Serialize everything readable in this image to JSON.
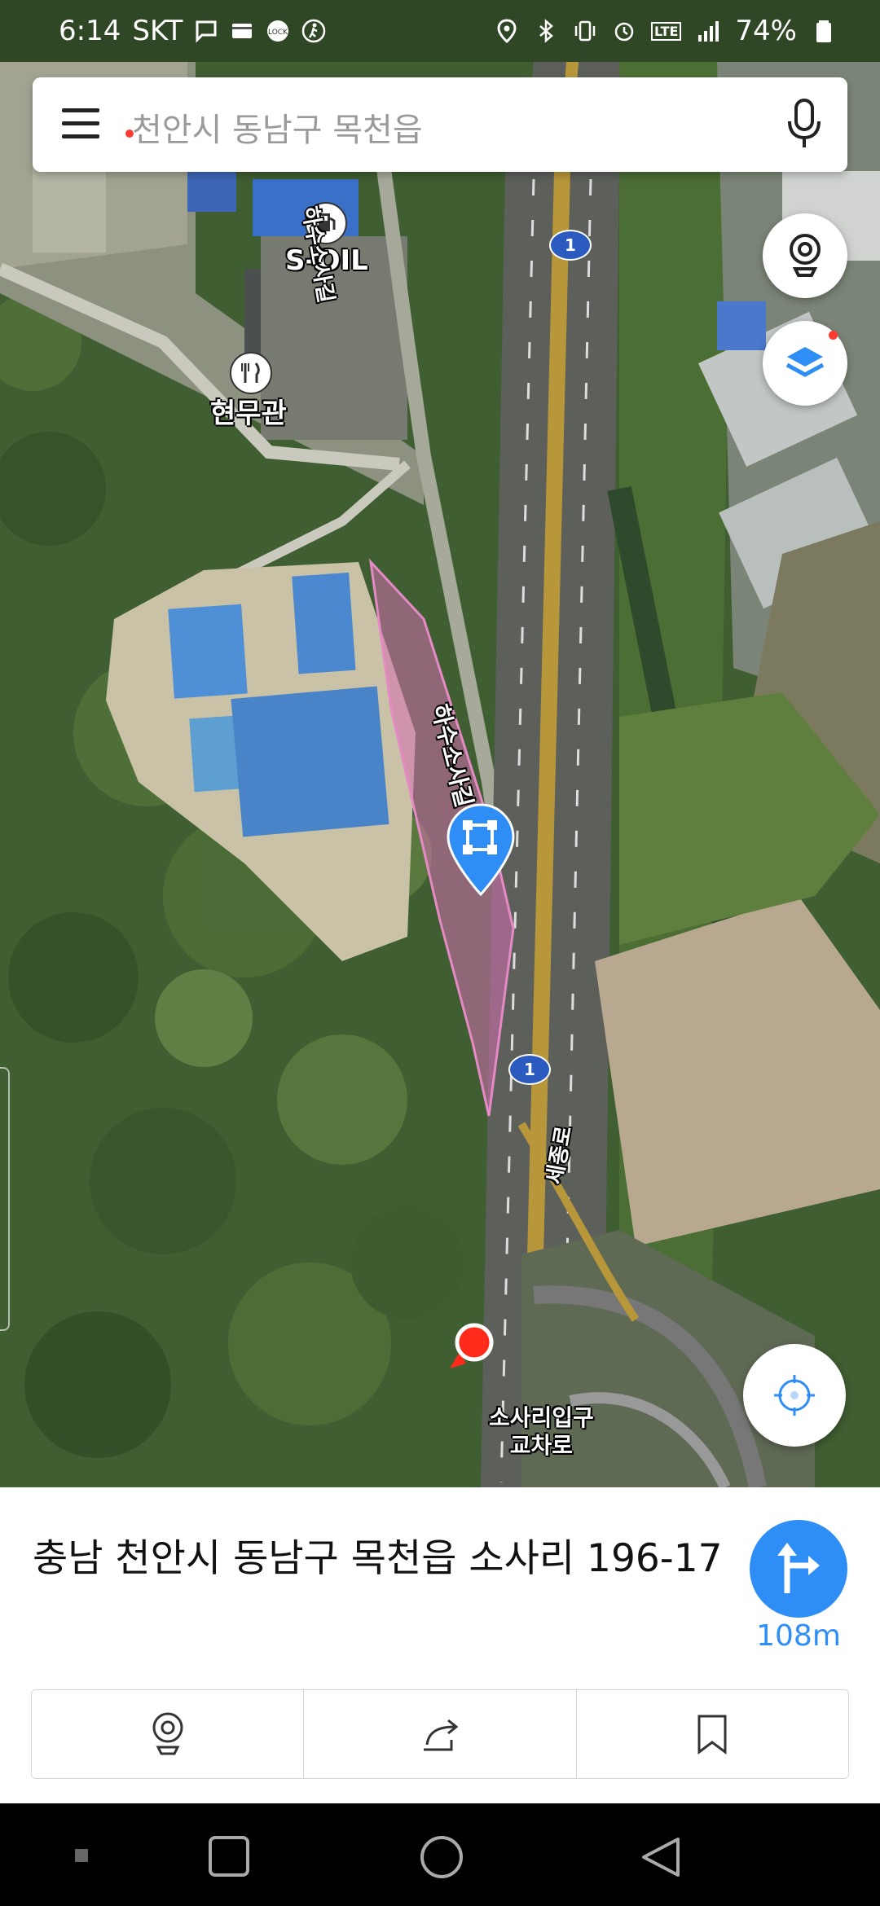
{
  "status_bar": {
    "time": "6:14",
    "carrier": "SKT",
    "battery": "74%",
    "network": "LTE"
  },
  "search": {
    "placeholder": "천안시 동남구 목천읍"
  },
  "map": {
    "labels": {
      "gas_station": "S-OIL",
      "restaurant": "현무관",
      "road_hasu_north": "하수소사길",
      "road_hasu_mid": "하수소사길",
      "road_sejong": "세종로",
      "intersection": "소사리입구\n교차로"
    },
    "route_shield_number": "1"
  },
  "place": {
    "address": "충남 천안시 동남구 목천읍 소사리 196-17",
    "distance": "108m"
  },
  "colors": {
    "accent": "#2f8ef5",
    "parcel_fill": "#d46fb0",
    "red_marker": "#ff2a1a",
    "highway": "#b8963a"
  },
  "icons": {
    "menu": "menu-icon",
    "mic": "microphone-icon",
    "street_view": "street-view-icon",
    "layers": "layers-icon",
    "my_location": "crosshair-icon",
    "route": "directions-icon",
    "share": "share-icon",
    "bookmark": "bookmark-icon"
  }
}
